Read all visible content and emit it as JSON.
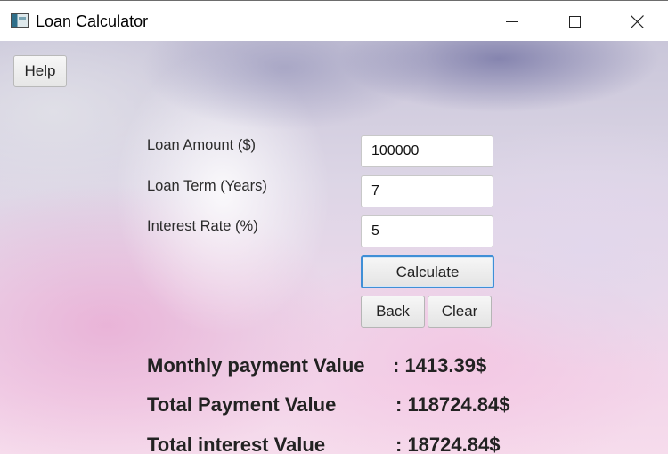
{
  "window": {
    "title": "Loan Calculator"
  },
  "toolbar": {
    "help_label": "Help"
  },
  "form": {
    "loan_amount_label": "Loan Amount ($)",
    "loan_term_label": "Loan Term (Years)",
    "interest_rate_label": "Interest Rate (%)",
    "loan_amount_value": "100000",
    "loan_term_value": "7",
    "interest_rate_value": "5"
  },
  "buttons": {
    "calculate": "Calculate",
    "back": "Back",
    "clear": "Clear"
  },
  "results": {
    "monthly_label": "Monthly payment Value",
    "monthly_value": ": 1413.39$",
    "total_label": "Total Payment Value",
    "total_value": ":  118724.84$",
    "interest_label": "Total interest Value",
    "interest_value": ": 18724.84$"
  },
  "icons": {
    "app": "app-window-icon",
    "minimize": "minimize-icon",
    "maximize": "maximize-icon",
    "close": "close-icon"
  },
  "colors": {
    "focus_border": "#3f8fd6"
  }
}
